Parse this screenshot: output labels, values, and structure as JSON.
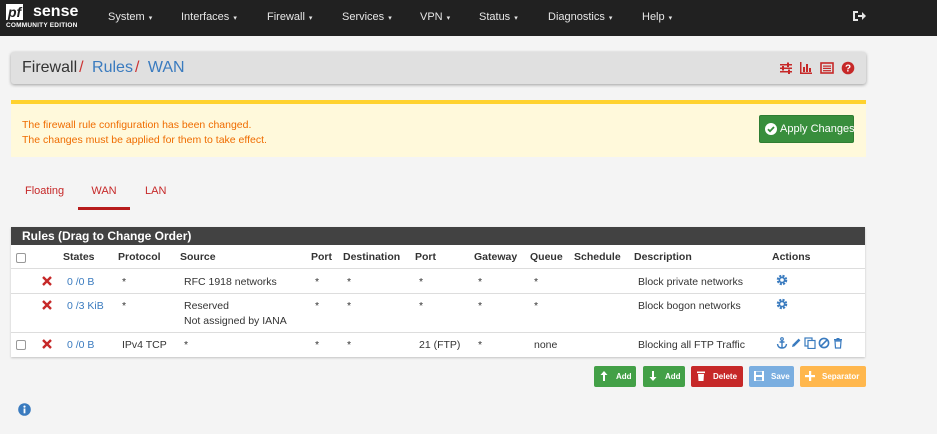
{
  "brand": {
    "prefix": "pf",
    "name": "sense",
    "edition": "COMMUNITY EDITION"
  },
  "nav": {
    "items": [
      {
        "label": "System"
      },
      {
        "label": "Interfaces"
      },
      {
        "label": "Firewall"
      },
      {
        "label": "Services"
      },
      {
        "label": "VPN"
      },
      {
        "label": "Status"
      },
      {
        "label": "Diagnostics"
      },
      {
        "label": "Help"
      }
    ],
    "caret": "▾"
  },
  "breadcrumb": {
    "root": "Firewall",
    "sep": "/",
    "section": "Rules",
    "current": "WAN"
  },
  "alert": {
    "line1": "The firewall rule configuration has been changed.",
    "line2": "The changes must be applied for them to take effect.",
    "apply_label": "Apply Changes"
  },
  "tabs": [
    {
      "label": "Floating"
    },
    {
      "label": "WAN"
    },
    {
      "label": "LAN"
    }
  ],
  "panel": {
    "title": "Rules (Drag to Change Order)"
  },
  "columns": {
    "states": "States",
    "protocol": "Protocol",
    "source": "Source",
    "port1": "Port",
    "destination": "Destination",
    "port2": "Port",
    "gateway": "Gateway",
    "queue": "Queue",
    "schedule": "Schedule",
    "description": "Description",
    "actions": "Actions"
  },
  "rows": [
    {
      "states": "0 /0 B",
      "protocol": "*",
      "source": "RFC 1918 networks",
      "source2": "",
      "port1": "*",
      "destination": "*",
      "port2": "*",
      "gateway": "*",
      "queue": "*",
      "schedule": "",
      "description": "Block private networks"
    },
    {
      "states": "0 /3 KiB",
      "protocol": "*",
      "source": "Reserved",
      "source2": "Not assigned by IANA",
      "port1": "*",
      "destination": "*",
      "port2": "*",
      "gateway": "*",
      "queue": "*",
      "schedule": "",
      "description": "Block bogon networks"
    },
    {
      "states": "0 /0 B",
      "protocol": "IPv4 TCP",
      "source": "*",
      "source2": "",
      "port1": "*",
      "destination": "*",
      "port2": "21 (FTP)",
      "gateway": "*",
      "queue": "none",
      "schedule": "",
      "description": "Blocking all FTP Traffic"
    }
  ],
  "buttons": {
    "add_top": "Add",
    "add_bottom": "Add",
    "delete": "Delete",
    "save": "Save",
    "separator": "Separator"
  },
  "colors": {
    "nav_bg": "#212121",
    "accent_red": "#c62828",
    "link_blue": "#3a7bbf",
    "success": "#388e3c",
    "danger": "#c62828",
    "info": "#7aaee0",
    "warning": "#ffb74d"
  }
}
